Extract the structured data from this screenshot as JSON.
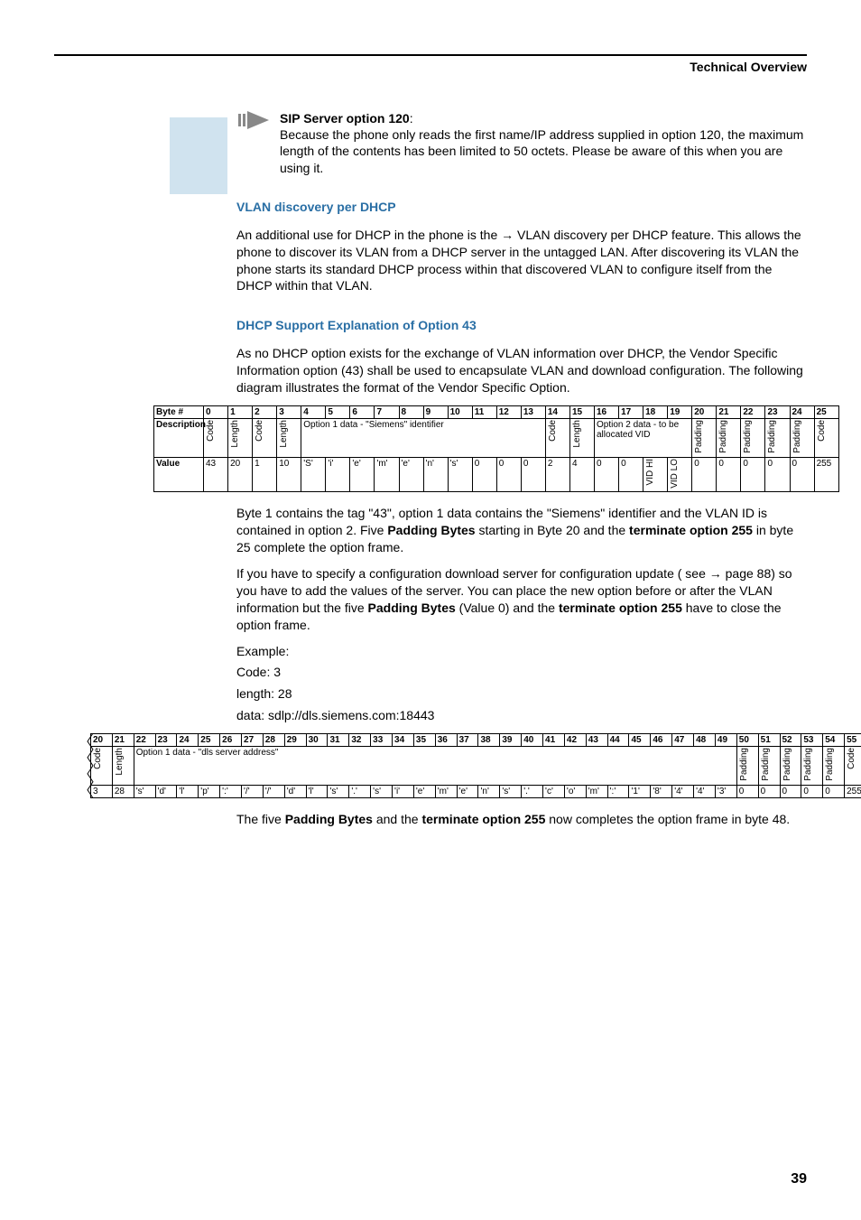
{
  "header": {
    "section": "Technical Overview"
  },
  "note": {
    "title": "SIP Server option 120",
    "colon": ":",
    "body": "Because the phone only reads the first name/IP address supplied in option 120, the maximum length of the contents has been limited to 50 octets. Please be aware of this when you are using it."
  },
  "sections": {
    "vlan_heading": "VLAN discovery per DHCP",
    "vlan_para": "An additional use for DHCP in the phone is the → VLAN discovery per DHCP feature. This allows the phone to discover its VLAN from a DHCP server in the untagged LAN. After discovering its VLAN the phone starts its standard DHCP process within that discovered VLAN to configure itself from the DHCP within that VLAN.",
    "dhcp_heading": "DHCP Support Explanation of Option 43",
    "dhcp_para": "As no DHCP option exists for the exchange of VLAN information over DHCP, the Vendor Specific Information option (43) shall be used to encapsulate VLAN and download configuration. The following diagram illustrates the format of the Vendor Specific Option."
  },
  "table1": {
    "byte_label": "Byte #",
    "desc_label": "Description",
    "value_label": "Value",
    "headers": [
      "0",
      "1",
      "2",
      "3",
      "4",
      "5",
      "6",
      "7",
      "8",
      "9",
      "10",
      "11",
      "12",
      "13",
      "14",
      "15",
      "16",
      "17",
      "18",
      "19",
      "20",
      "21",
      "22",
      "23",
      "24",
      "25"
    ],
    "desc": {
      "c0": "Code",
      "c1": "Length",
      "c2": "Code",
      "c3": "Length",
      "opt1_span": "Option 1 data - \"Siemens\" identifier",
      "c14": "Code",
      "c15": "Length",
      "opt2_vid": "Option 2 data - to be allocated VID",
      "c20": "Padding",
      "c21": "Padding",
      "c22": "Padding",
      "c23": "Padding",
      "c24": "Padding",
      "c25": "Code"
    },
    "values": [
      "43",
      "20",
      "1",
      "10",
      "'S'",
      "'i'",
      "'e'",
      "'m'",
      "'e'",
      "'n'",
      "'s'",
      "0",
      "0",
      "0",
      "2",
      "4",
      "0",
      "0",
      "VID HI",
      "VID LO",
      "0",
      "0",
      "0",
      "0",
      "0",
      "255"
    ]
  },
  "mid": {
    "p1a": "Byte 1 contains the tag \"43\", option 1 data contains the \"Siemens\" identifier and the VLAN ID is contained in option 2. Five ",
    "p1b": "Padding Bytes",
    "p1c": " starting in Byte 20 and the ",
    "p1d": "terminate option 255",
    "p1e": " in byte 25 complete the option frame.",
    "p2a": "If you have to specify a configuration download server for configuration update ( see → page 88) so you have to add the values of the server. You can place the new option before or after the VLAN information but the five ",
    "p2b": "Padding Bytes",
    "p2c": " (Value 0) and the ",
    "p2d": "terminate option 255",
    "p2e": " have to close the option frame.",
    "example_label": "Example:",
    "code_line": "Code: 3",
    "len_line": "length: 28",
    "data_line": "data: sdlp://dls.siemens.com:18443"
  },
  "table2": {
    "headers": [
      "20",
      "21",
      "22",
      "23",
      "24",
      "25",
      "26",
      "27",
      "28",
      "29",
      "30",
      "31",
      "32",
      "33",
      "34",
      "35",
      "36",
      "37",
      "38",
      "39",
      "40",
      "41",
      "42",
      "43",
      "44",
      "45",
      "46",
      "47",
      "48",
      "49",
      "50",
      "51",
      "52",
      "53",
      "54",
      "55"
    ],
    "desc": {
      "c0": "Code",
      "c1": "Length",
      "opt1_span": "Option 1 data - \"dls server address\"",
      "c50": "Padding",
      "c51": "Padding",
      "c52": "Padding",
      "c53": "Padding",
      "c54": "Padding",
      "c55": "Code"
    },
    "values": [
      "3",
      "28",
      "'s'",
      "'d'",
      "'l'",
      "'p'",
      "':'",
      "'/'",
      "'/'",
      "'d'",
      "'l'",
      "'s'",
      "'.'",
      "'s'",
      "'i'",
      "'e'",
      "'m'",
      "'e'",
      "'n'",
      "'s'",
      "'.'",
      "'c'",
      "'o'",
      "'m'",
      "':'",
      "'1'",
      "'8'",
      "'4'",
      "'4'",
      "'3'",
      "0",
      "0",
      "0",
      "0",
      "0",
      "255"
    ]
  },
  "closing": {
    "a": "The five ",
    "b": "Padding Bytes",
    "c": " and the ",
    "d": "terminate option 255",
    "e": " now completes the option frame in byte 48."
  },
  "page_number": "39"
}
